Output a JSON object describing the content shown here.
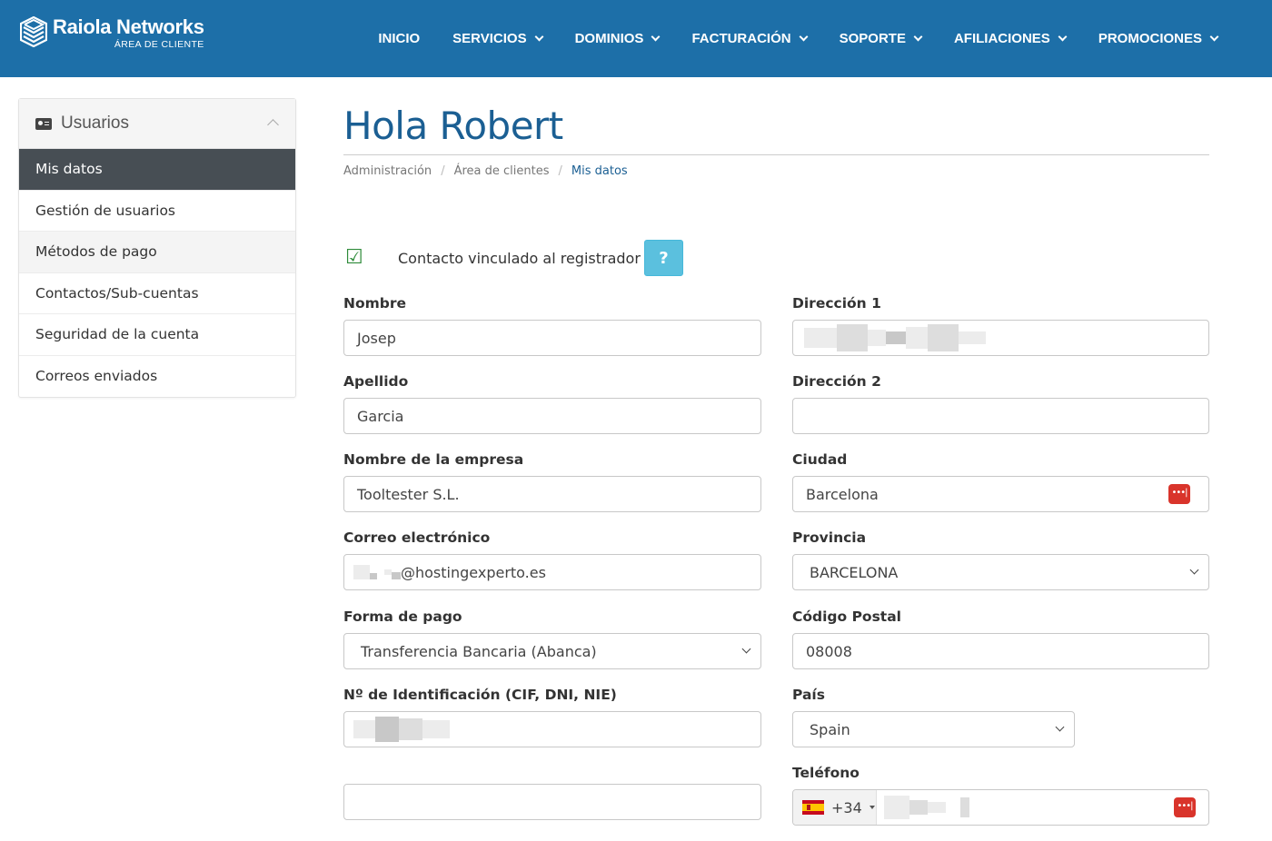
{
  "header": {
    "brand_name": "Raiola Networks",
    "brand_sub": "ÁREA DE CLIENTE",
    "nav": [
      {
        "label": "INICIO",
        "dropdown": false
      },
      {
        "label": "SERVICIOS",
        "dropdown": true
      },
      {
        "label": "DOMINIOS",
        "dropdown": true
      },
      {
        "label": "FACTURACIÓN",
        "dropdown": true
      },
      {
        "label": "SOPORTE",
        "dropdown": true
      },
      {
        "label": "AFILIACIONES",
        "dropdown": true
      },
      {
        "label": "PROMOCIONES",
        "dropdown": true
      }
    ],
    "bg_color": "#1d6fa8"
  },
  "sidebar": {
    "title": "Usuarios",
    "icon": "id-card-icon",
    "items": [
      {
        "label": "Mis datos",
        "active": true
      },
      {
        "label": "Gestión de usuarios"
      },
      {
        "label": "Métodos de pago"
      },
      {
        "label": "Contactos/Sub-cuentas"
      },
      {
        "label": "Seguridad de la cuenta"
      },
      {
        "label": "Correos enviados"
      }
    ]
  },
  "main": {
    "title": "Hola Robert",
    "breadcrumb": [
      "Administración",
      "Área de clientes",
      "Mis datos"
    ],
    "registrar_contact": {
      "label": "Contacto vinculado al registrador",
      "checked": true,
      "help": "?"
    },
    "fields": {
      "nombre": {
        "label": "Nombre",
        "value": "Josep"
      },
      "apellido": {
        "label": "Apellido",
        "value": "Garcia"
      },
      "empresa": {
        "label": "Nombre de la empresa",
        "value": "Tooltester S.L."
      },
      "email": {
        "label": "Correo electrónico",
        "value_suffix": "@hostingexperto.es"
      },
      "forma_pago": {
        "label": "Forma de pago",
        "value": "Transferencia Bancaria (Abanca)"
      },
      "identificacion": {
        "label": "Nº de Identificación (CIF, DNI, NIE)",
        "value": ""
      },
      "extra": {
        "value": ""
      },
      "direccion1": {
        "label": "Dirección 1",
        "value": ""
      },
      "direccion2": {
        "label": "Dirección 2",
        "value": ""
      },
      "ciudad": {
        "label": "Ciudad",
        "value": "Barcelona"
      },
      "provincia": {
        "label": "Provincia",
        "value": "BARCELONA"
      },
      "codigo_postal": {
        "label": "Código Postal",
        "value": "08008"
      },
      "pais": {
        "label": "País",
        "value": "Spain"
      },
      "telefono": {
        "label": "Teléfono",
        "prefix": "+34",
        "flag": "spain-flag-icon"
      }
    },
    "accent_color": "#1b5f93"
  }
}
